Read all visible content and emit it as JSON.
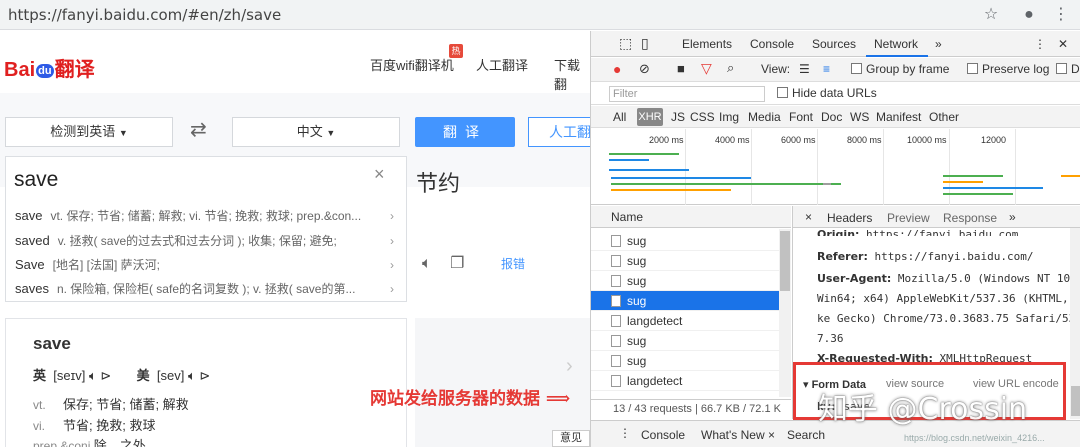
{
  "browser": {
    "url": "https://fanyi.baidu.com/#en/zh/save",
    "star_icon": "star-icon",
    "avatar_icon": "account-icon",
    "menu_icon": "kebab-menu-icon"
  },
  "baidu": {
    "logo": {
      "bai": "Bai",
      "du": "du",
      "fanyi": "翻译"
    },
    "nav": [
      "百度wifi翻译机",
      "人工翻译",
      "下载翻"
    ],
    "hot_badge": "热",
    "source_lang": "检测到英语",
    "target_lang": "中文",
    "swap": "⇄",
    "translate_btn": "翻译",
    "human_btn": "人工翻",
    "input_text": "save",
    "clear": "×",
    "suggestions": [
      {
        "word": "save",
        "def": "vt. 保存; 节省; 储蓄; 解救; vi. 节省; 挽救; 救球; prep.&con..."
      },
      {
        "word": "saved",
        "def": "v. 拯救( save的过去式和过去分词 ); 收集; 保留; 避免;"
      },
      {
        "word": "Save",
        "def": "[地名] [法国] 萨沃河;"
      },
      {
        "word": "saves",
        "def": "n. 保险箱, 保险柜( safe的名词复数 ); v. 拯救( save的第..."
      }
    ],
    "result_word": "节约",
    "report": "报错",
    "dict": {
      "word": "save",
      "uk_label": "英",
      "uk_phon": "[seɪv]",
      "us_label": "美",
      "us_phon": "[sev]",
      "defs": [
        {
          "pos": "vt.",
          "text": "保存; 节省; 储蓄; 解救"
        },
        {
          "pos": "vi.",
          "text": "节省; 挽救; 救球"
        },
        {
          "pos": "prep.&conj.",
          "text": "除…之外"
        }
      ]
    },
    "feedback": "意见"
  },
  "annotation": "网站发给服务器的数据 ⟹",
  "devtools": {
    "tabs": [
      "Elements",
      "Console",
      "Sources",
      "Network",
      "»"
    ],
    "active_tab": "Network",
    "toolbar": {
      "view": "View:",
      "group": "Group by frame",
      "preserve": "Preserve log",
      "disable": "D"
    },
    "filter_placeholder": "Filter",
    "hide_data_urls": "Hide data URLs",
    "types": [
      "All",
      "XHR",
      "JS",
      "CSS",
      "Img",
      "Media",
      "Font",
      "Doc",
      "WS",
      "Manifest",
      "Other"
    ],
    "ticks": [
      "2000 ms",
      "4000 ms",
      "6000 ms",
      "8000 ms",
      "10000 ms",
      "12000"
    ],
    "name_header": "Name",
    "requests": [
      "sug",
      "sug",
      "sug",
      "sug",
      "langdetect",
      "sug",
      "sug",
      "langdetect"
    ],
    "selected_index": 3,
    "status": "13 / 43 requests | 66.7 KB / 72.1 K",
    "detail_tabs": [
      "×",
      "Headers",
      "Preview",
      "Response",
      "»"
    ],
    "headers": [
      {
        "name": "Origin:",
        "value": "https://fanyi.baidu.com"
      },
      {
        "name": "Referer:",
        "value": "https://fanyi.baidu.com/"
      },
      {
        "name": "User-Agent:",
        "value": "Mozilla/5.0 (Windows NT 10.0;"
      },
      {
        "name": "",
        "value": "Win64; x64) AppleWebKit/537.36 (KHTML, l"
      },
      {
        "name": "",
        "value": "ke Gecko) Chrome/73.0.3683.75 Safari/53"
      },
      {
        "name": "",
        "value": "7.36"
      },
      {
        "name": "X-Requested-With:",
        "value": "XMLHttpRequest"
      }
    ],
    "form_data": {
      "label": "▾ Form Data",
      "view_source": "view source",
      "view_url": "view URL encode",
      "kw": "kw:",
      "kw_val": "save"
    },
    "drawer": [
      "Console",
      "What's New ×",
      "Search"
    ],
    "watermark": "知乎 @Crossin",
    "wm_small": "https://blog.csdn.net/weixin_4216..."
  }
}
